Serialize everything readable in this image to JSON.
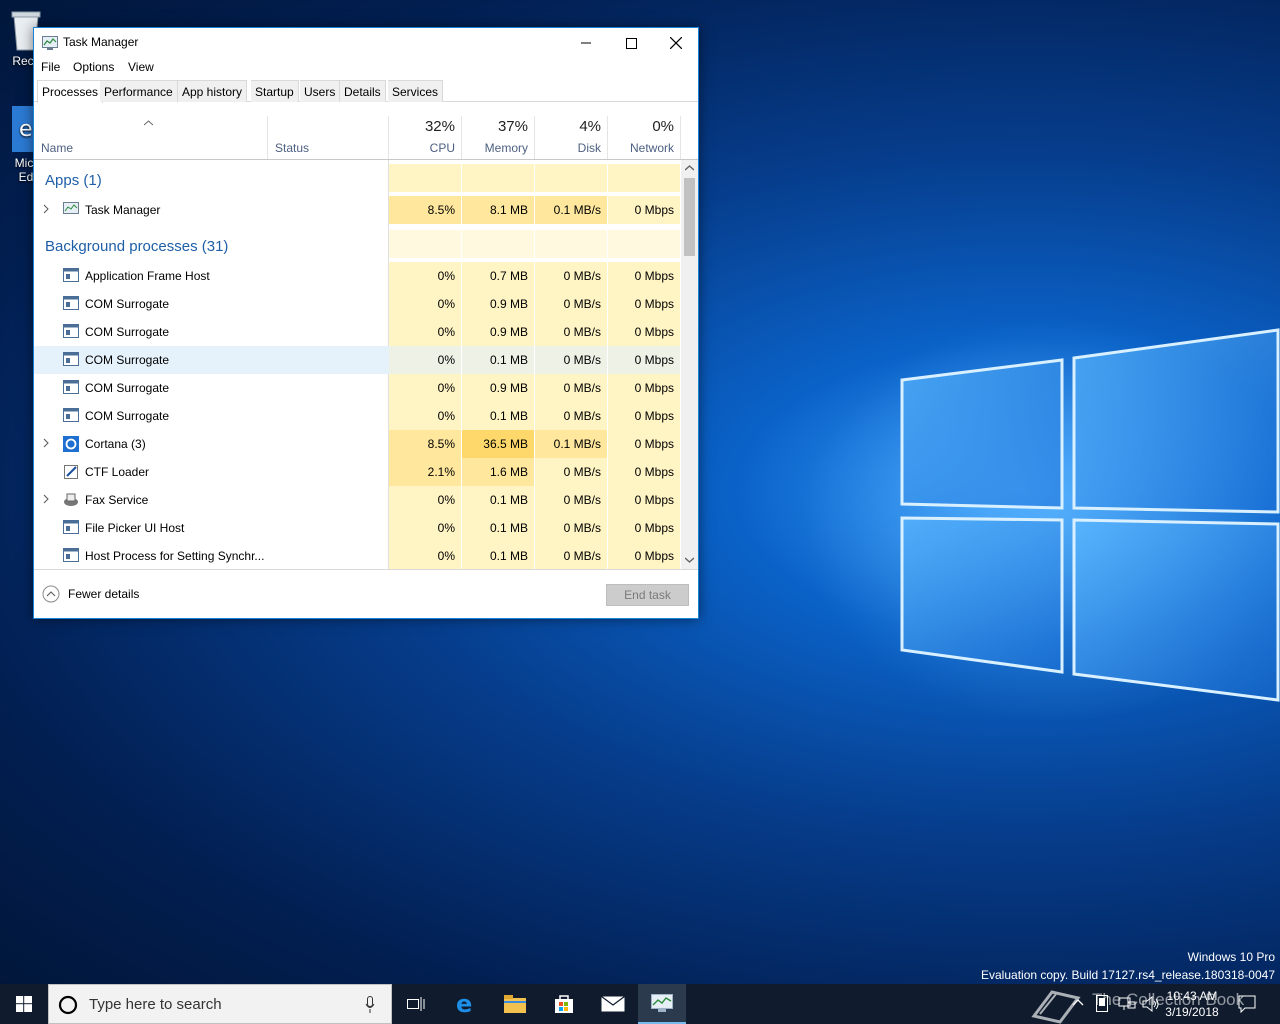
{
  "desktop": {
    "icons": [
      {
        "label": "Recy",
        "icon": "recycle-bin-icon"
      },
      {
        "label": "Micr\nEd",
        "icon": "edge-shortcut-icon"
      }
    ],
    "watermark": {
      "line1": "Windows 10 Pro",
      "line2": "Evaluation copy. Build 17127.rs4_release.180318-0047"
    },
    "overlay_text": "The Collection Book"
  },
  "window": {
    "title": "Task Manager",
    "menu": [
      "File",
      "Options",
      "View"
    ],
    "tabs": [
      "Processes",
      "Performance",
      "App history",
      "Startup",
      "Users",
      "Details",
      "Services"
    ],
    "active_tab": "Processes",
    "columns": {
      "name": "Name",
      "status": "Status",
      "cpu": {
        "pct": "32%",
        "label": "CPU"
      },
      "memory": {
        "pct": "37%",
        "label": "Memory"
      },
      "disk": {
        "pct": "4%",
        "label": "Disk"
      },
      "network": {
        "pct": "0%",
        "label": "Network"
      }
    },
    "groups": {
      "apps": "Apps (1)",
      "background": "Background processes (31)"
    },
    "rows": [
      {
        "name": "Task Manager",
        "cpu": "8.5%",
        "mem": "8.1 MB",
        "disk": "0.1 MB/s",
        "net": "0 Mbps"
      },
      {
        "name": "Application Frame Host",
        "cpu": "0%",
        "mem": "0.7 MB",
        "disk": "0 MB/s",
        "net": "0 Mbps"
      },
      {
        "name": "COM Surrogate",
        "cpu": "0%",
        "mem": "0.9 MB",
        "disk": "0 MB/s",
        "net": "0 Mbps"
      },
      {
        "name": "COM Surrogate",
        "cpu": "0%",
        "mem": "0.9 MB",
        "disk": "0 MB/s",
        "net": "0 Mbps"
      },
      {
        "name": "COM Surrogate",
        "cpu": "0%",
        "mem": "0.1 MB",
        "disk": "0 MB/s",
        "net": "0 Mbps"
      },
      {
        "name": "COM Surrogate",
        "cpu": "0%",
        "mem": "0.9 MB",
        "disk": "0 MB/s",
        "net": "0 Mbps"
      },
      {
        "name": "COM Surrogate",
        "cpu": "0%",
        "mem": "0.1 MB",
        "disk": "0 MB/s",
        "net": "0 Mbps"
      },
      {
        "name": "Cortana (3)",
        "cpu": "8.5%",
        "mem": "36.5 MB",
        "disk": "0.1 MB/s",
        "net": "0 Mbps"
      },
      {
        "name": "CTF Loader",
        "cpu": "2.1%",
        "mem": "1.6 MB",
        "disk": "0 MB/s",
        "net": "0 Mbps"
      },
      {
        "name": "Fax Service",
        "cpu": "0%",
        "mem": "0.1 MB",
        "disk": "0 MB/s",
        "net": "0 Mbps"
      },
      {
        "name": "File Picker UI Host",
        "cpu": "0%",
        "mem": "0.1 MB",
        "disk": "0 MB/s",
        "net": "0 Mbps"
      },
      {
        "name": "Host Process for Setting Synchr...",
        "cpu": "0%",
        "mem": "0.1 MB",
        "disk": "0 MB/s",
        "net": "0 Mbps"
      }
    ],
    "fewer_details": "Fewer details",
    "end_task": "End task"
  },
  "taskbar": {
    "search_placeholder": "Type here to search",
    "time": "10:43 AM",
    "date": "3/19/2018"
  },
  "colors": {
    "accent": "#1883d7",
    "heat_light": "#fff4c4",
    "heat_mid": "#ffe89e",
    "heat_high": "#ffd86b",
    "group_text": "#1e5fa8"
  }
}
